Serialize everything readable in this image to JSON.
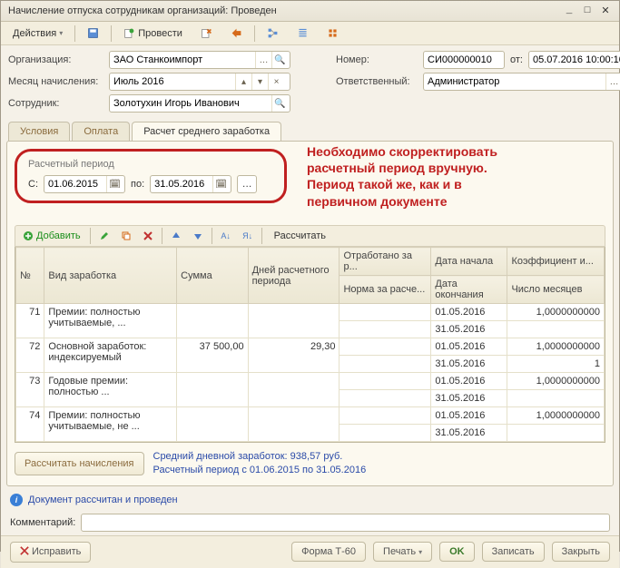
{
  "window": {
    "title": "Начисление отпуска сотрудникам организаций: Проведен"
  },
  "toolbar": {
    "actions": "Действия",
    "conduct": "Провести"
  },
  "form": {
    "org_label": "Организация:",
    "org_value": "ЗАО Станкоимпорт",
    "month_label": "Месяц начисления:",
    "month_value": "Июль 2016",
    "emp_label": "Сотрудник:",
    "emp_value": "Золотухин Игорь Иванович",
    "number_label": "Номер:",
    "number_value": "СИ000000010",
    "from_label": "от:",
    "from_value": "05.07.2016 10:00:10",
    "resp_label": "Ответственный:",
    "resp_value": "Администратор"
  },
  "tabs": {
    "conditions": "Условия",
    "payment": "Оплата",
    "calc": "Расчет среднего заработка"
  },
  "period": {
    "title": "Расчетный период",
    "from_label": "С:",
    "from_value": "01.06.2015",
    "to_label": "по:",
    "to_value": "31.05.2016"
  },
  "note_text": "Необходимо скорректировать\nрасчетный период вручную.\nПериод такой же, как и в\nпервичном документе",
  "grid_toolbar": {
    "add": "Добавить",
    "calc": "Рассчитать"
  },
  "columns": {
    "no": "№",
    "type": "Вид заработка",
    "sum": "Сумма",
    "days": "Дней расчетного периода",
    "worked": "Отработано за р...",
    "norm": "Норма за расче...",
    "date_start": "Дата начала",
    "date_end": "Дата окончания",
    "coef": "Коэффициент и...",
    "months": "Число месяцев"
  },
  "rows": [
    {
      "no": "71",
      "type": "Премии: полностью учитываемые, ...",
      "sum": "",
      "days": "",
      "date1": "01.05.2016",
      "date2": "31.05.2016",
      "coef": "1,0000000000",
      "months": ""
    },
    {
      "no": "72",
      "type": "Основной заработок: индексируемый",
      "sum": "37 500,00",
      "days": "29,30",
      "date1": "01.05.2016",
      "date2": "31.05.2016",
      "coef": "1,0000000000",
      "months": "1"
    },
    {
      "no": "73",
      "type": "Годовые премии: полностью ...",
      "sum": "",
      "days": "",
      "date1": "01.05.2016",
      "date2": "31.05.2016",
      "coef": "1,0000000000",
      "months": ""
    },
    {
      "no": "74",
      "type": "Премии: полностью учитываемые, не ...",
      "sum": "",
      "days": "",
      "date1": "01.05.2016",
      "date2": "31.05.2016",
      "coef": "1,0000000000",
      "months": ""
    }
  ],
  "summary": {
    "calc_btn": "Рассчитать начисления",
    "line1": "Средний дневной заработок: 938,57 руб.",
    "line2": "Расчетный период с 01.06.2015 по 31.05.2016"
  },
  "status": "Документ рассчитан и проведен",
  "comment_label": "Комментарий:",
  "bottom": {
    "fix": "Исправить",
    "form": "Форма Т-60",
    "print": "Печать",
    "ok": "OK",
    "save": "Записать",
    "close": "Закрыть"
  }
}
